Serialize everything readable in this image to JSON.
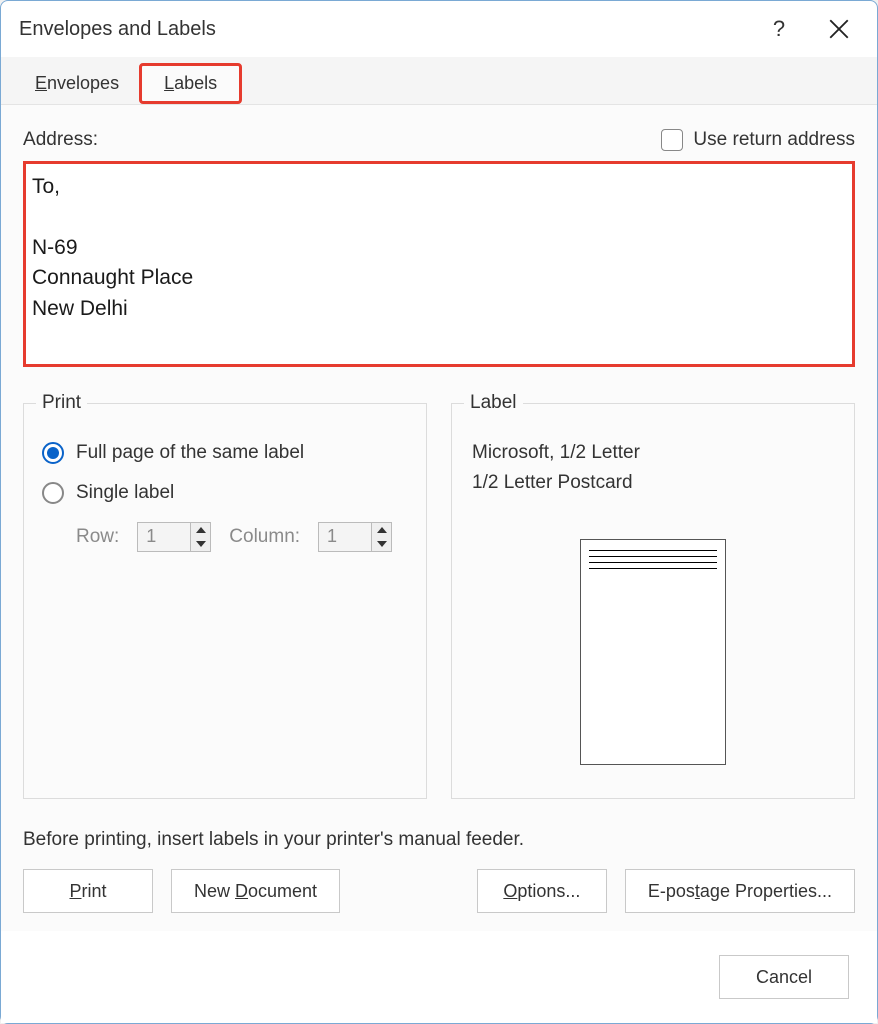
{
  "title": "Envelopes and Labels",
  "tabs": {
    "envelopes": "Envelopes",
    "labels": "Labels"
  },
  "address": {
    "label": "Address:",
    "use_return": "Use return address",
    "text": "To,\n\nN-69\nConnaught Place\nNew Delhi"
  },
  "print": {
    "legend": "Print",
    "full_page": "Full page of the same label",
    "single": "Single label",
    "row_label": "Row:",
    "row_value": "1",
    "col_label": "Column:",
    "col_value": "1"
  },
  "label": {
    "legend": "Label",
    "vendor": "Microsoft, 1/2 Letter",
    "product": "1/2 Letter Postcard"
  },
  "hint": "Before printing, insert labels in your printer's manual feeder.",
  "buttons": {
    "print": "Print",
    "newdoc": "New Document",
    "options": "Options...",
    "epostage": "E-postage Properties...",
    "cancel": "Cancel"
  }
}
